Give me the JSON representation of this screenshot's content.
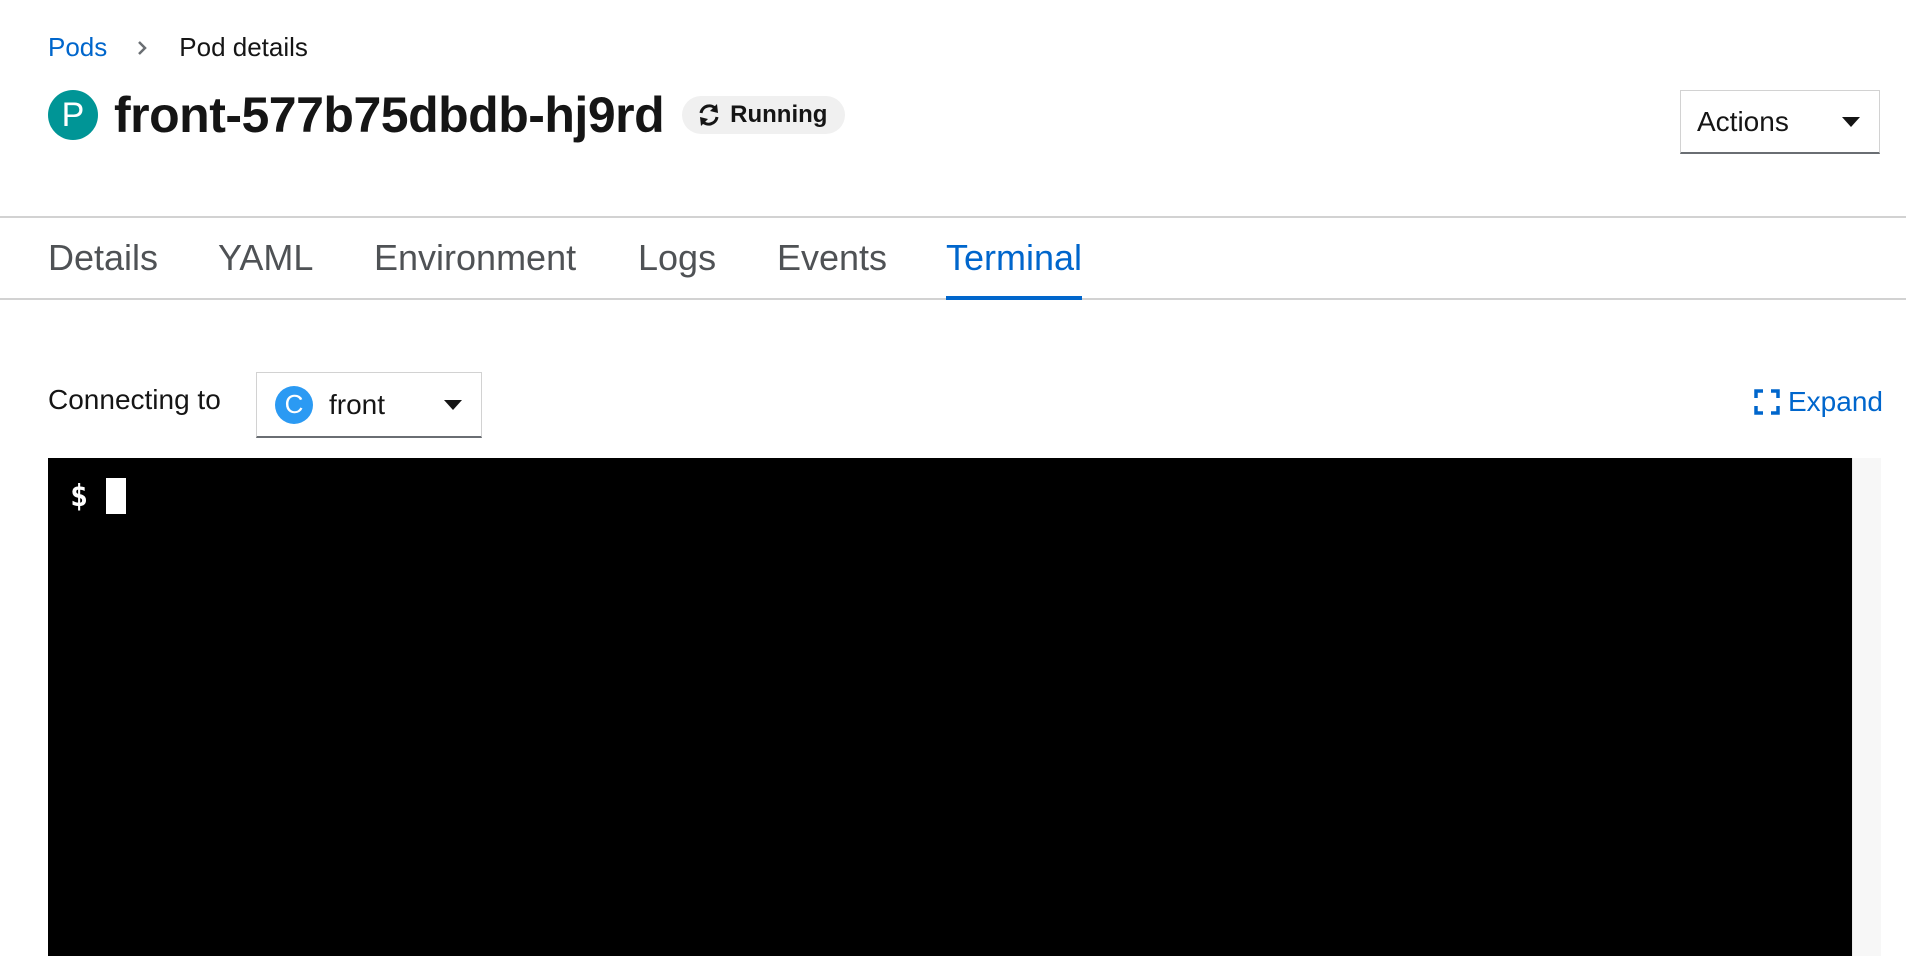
{
  "breadcrumb": {
    "parent": "Pods",
    "current": "Pod details"
  },
  "resource": {
    "kind_badge": "P",
    "name": "front-577b75dbdb-hj9rd",
    "status": "Running",
    "status_icon": "sync-icon"
  },
  "actions": {
    "label": "Actions"
  },
  "tabs": [
    {
      "label": "Details"
    },
    {
      "label": "YAML"
    },
    {
      "label": "Environment"
    },
    {
      "label": "Logs"
    },
    {
      "label": "Events"
    },
    {
      "label": "Terminal",
      "active": true
    }
  ],
  "terminal": {
    "connecting_label": "Connecting to",
    "container_badge": "C",
    "container_name": "front",
    "expand_label": "Expand",
    "prompt": "$"
  },
  "colors": {
    "link": "#0066cc",
    "pod_badge": "#009596",
    "container_badge": "#2b9af3",
    "terminal_bg": "#000000"
  }
}
